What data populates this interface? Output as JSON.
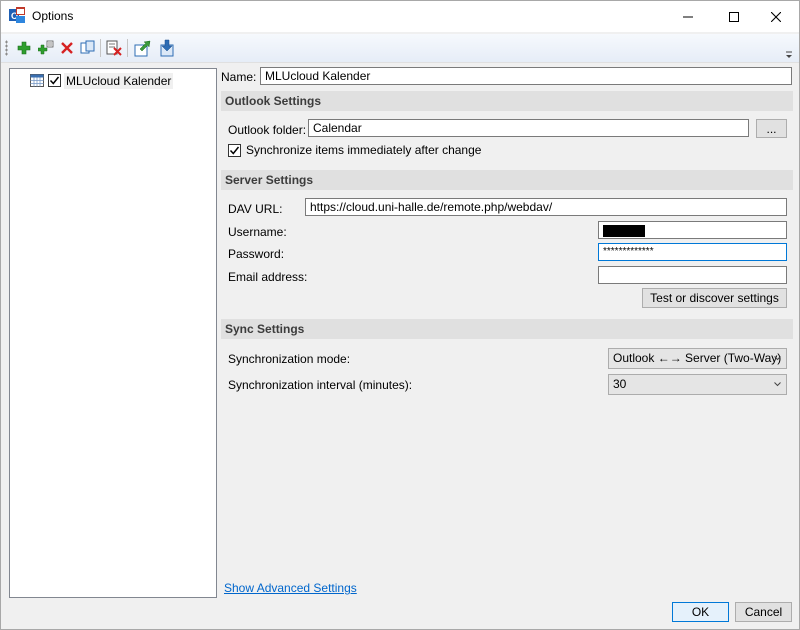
{
  "window": {
    "title": "Options",
    "app_icon": "outlook-caldav-icon"
  },
  "toolbar": {
    "icons": [
      "add-icon",
      "add-multiple-icon",
      "delete-icon",
      "copy-icon",
      "clear-cache-icon",
      "export-icon",
      "import-icon"
    ]
  },
  "tree": {
    "items": [
      {
        "label": "MLUcloud Kalender",
        "checked": true,
        "icon": "calendar-icon"
      }
    ]
  },
  "form": {
    "name_label": "Name:",
    "name_value": "MLUcloud Kalender",
    "outlook_section": "Outlook Settings",
    "outlook_folder_label": "Outlook folder:",
    "outlook_folder_value": "Calendar",
    "browse_label": "...",
    "sync_immediately_label": "Synchronize items immediately after change",
    "sync_immediately_checked": true,
    "server_section": "Server Settings",
    "dav_url_label": "DAV URL:",
    "dav_url_value": "https://cloud.uni-halle.de/remote.php/webdav/",
    "username_label": "Username:",
    "password_label": "Password:",
    "password_value": "*************",
    "email_label": "Email address:",
    "email_value": "",
    "test_button": "Test or discover settings",
    "sync_section": "Sync Settings",
    "sync_mode_label": "Synchronization mode:",
    "sync_mode_value": "Outlook ←→ Server (Two-Way)",
    "sync_interval_label": "Synchronization interval (minutes):",
    "sync_interval_value": "30"
  },
  "footer": {
    "advanced_link": "Show Advanced Settings",
    "ok_button": "OK",
    "cancel_button": "Cancel"
  },
  "colors": {
    "accent": "#0078d7",
    "link": "#0066cc",
    "section_bg": "#e0e0e0"
  }
}
